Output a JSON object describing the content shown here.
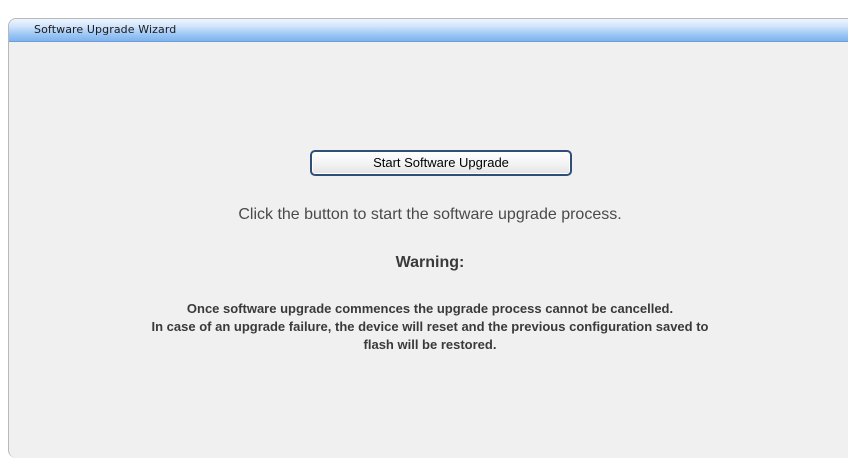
{
  "wizard": {
    "title": "Software Upgrade Wizard"
  },
  "main": {
    "start_button_label": "Start Software Upgrade",
    "instruction": "Click the button to start the software upgrade process.",
    "warning_title": "Warning:",
    "warning_lines": [
      "Once software upgrade commences the upgrade process cannot be cancelled.",
      "In case of an upgrade failure, the device will reset and the previous configuration saved to",
      "flash will be restored."
    ]
  },
  "colors": {
    "title_bar_gradient_top": "#eef6ff",
    "title_bar_gradient_bottom": "#7fb2ee",
    "panel_background": "#f0f0f0",
    "button_border": "#2f4f78"
  }
}
